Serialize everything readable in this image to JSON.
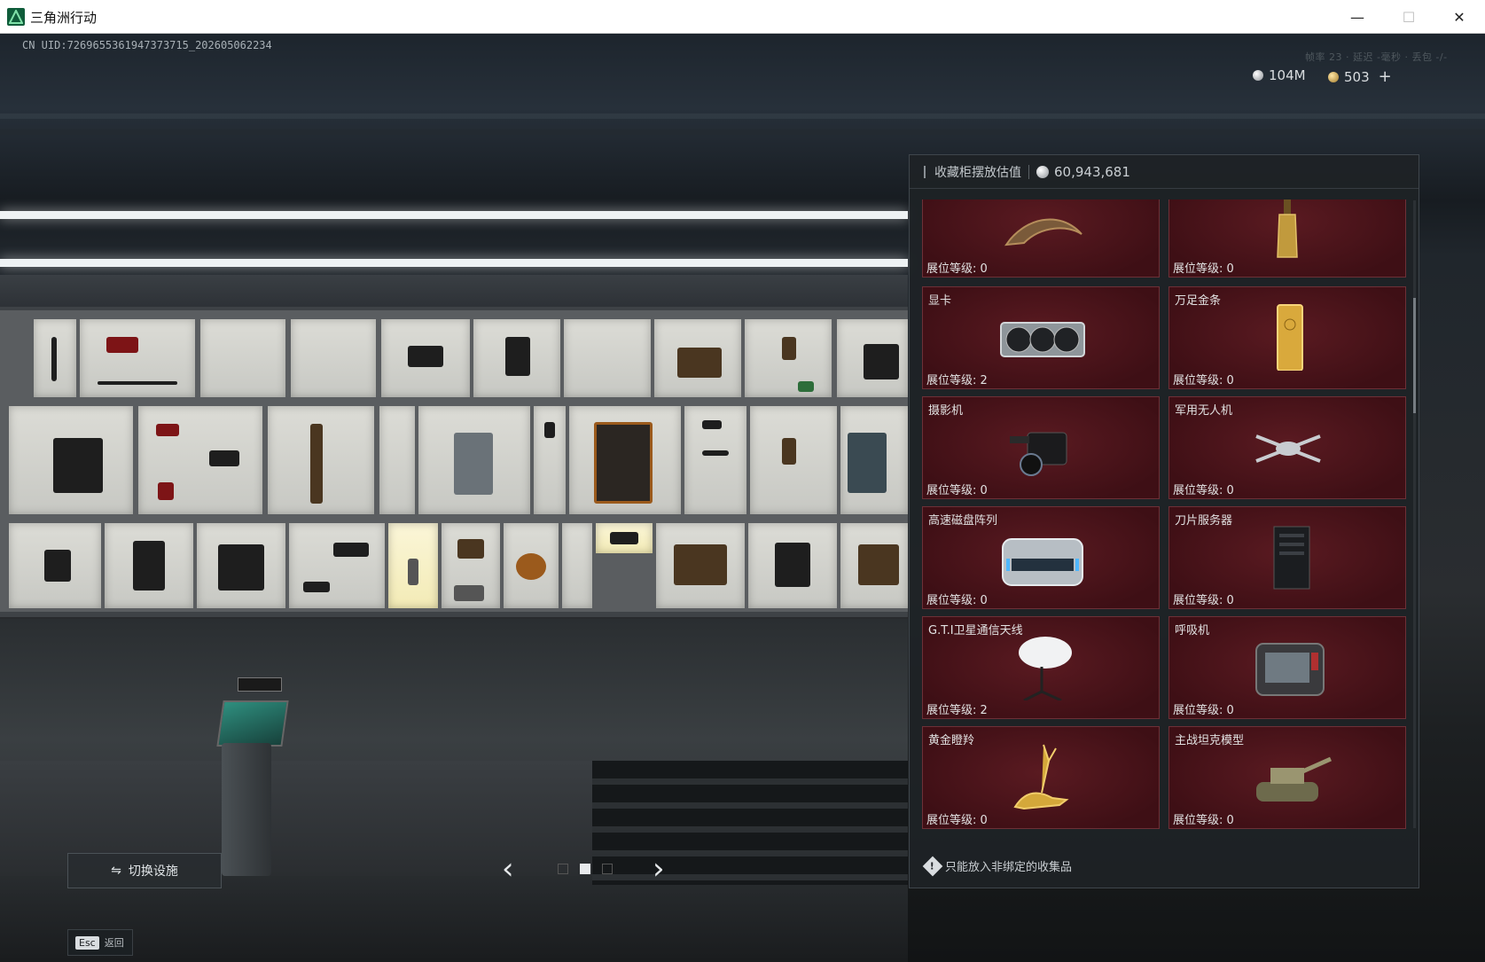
{
  "window": {
    "title": "三角洲行动",
    "minimize": "—",
    "maximize": "☐",
    "close": "✕"
  },
  "hud": {
    "uid": "CN UID:7269655361947373715_202605062234",
    "status": "帧率 23 · 延迟 -毫秒 · 丢包 -/-",
    "silver": "104M",
    "gold": "503",
    "plus": "+"
  },
  "panel": {
    "header_label": "收藏柜摆放估值",
    "header_value": "60,943,681",
    "notice": "只能放入非绑定的收集品",
    "notice_icon": "!",
    "items": [
      {
        "name": "",
        "level": "展位等级: 0",
        "icon": "claw"
      },
      {
        "name": "",
        "level": "展位等级: 0",
        "icon": "bottle"
      },
      {
        "name": "显卡",
        "level": "展位等级: 2",
        "icon": "gpu"
      },
      {
        "name": "万足金条",
        "level": "展位等级: 0",
        "icon": "gold-bar"
      },
      {
        "name": "摄影机",
        "level": "展位等级: 0",
        "icon": "camera"
      },
      {
        "name": "军用无人机",
        "level": "展位等级: 0",
        "icon": "drone"
      },
      {
        "name": "高速磁盘阵列",
        "level": "展位等级: 0",
        "icon": "disk-array"
      },
      {
        "name": "刀片服务器",
        "level": "展位等级: 0",
        "icon": "server"
      },
      {
        "name": "G.T.I卫星通信天线",
        "level": "展位等级: 2",
        "icon": "satellite-dish"
      },
      {
        "name": "呼吸机",
        "level": "展位等级: 0",
        "icon": "ventilator"
      },
      {
        "name": "黄金瞪羚",
        "level": "展位等级: 0",
        "icon": "gazelle"
      },
      {
        "name": "主战坦克模型",
        "level": "展位等级: 0",
        "icon": "tank"
      }
    ]
  },
  "bottom": {
    "switch_label": "切换设施",
    "switch_icon": "⇋",
    "prev": "‹",
    "next": "›",
    "esc_key": "Esc",
    "esc_label": "返回"
  }
}
